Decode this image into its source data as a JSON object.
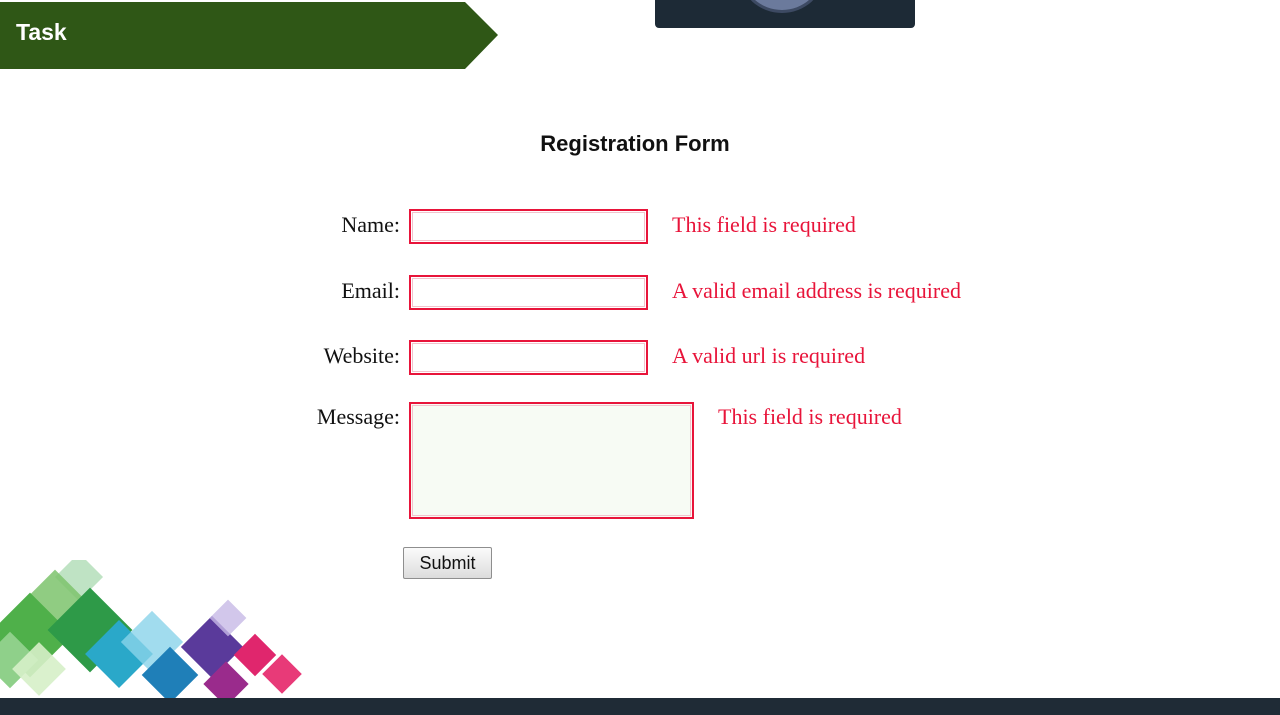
{
  "header": {
    "task_label": "Task"
  },
  "form": {
    "title": "Registration Form",
    "fields": [
      {
        "label": "Name:",
        "value": "",
        "error": "This field is required"
      },
      {
        "label": "Email:",
        "value": "",
        "error": "A valid email address is required"
      },
      {
        "label": "Website:",
        "value": "",
        "error": "A valid url is required"
      },
      {
        "label": "Message:",
        "value": "",
        "error": "This field is required"
      }
    ],
    "submit_label": "Submit"
  },
  "colors": {
    "banner": "#2f5716",
    "error": "#e8143a",
    "bottom_bar": "#1f2b36"
  },
  "icons": [
    "decorative-squares-graphic"
  ]
}
